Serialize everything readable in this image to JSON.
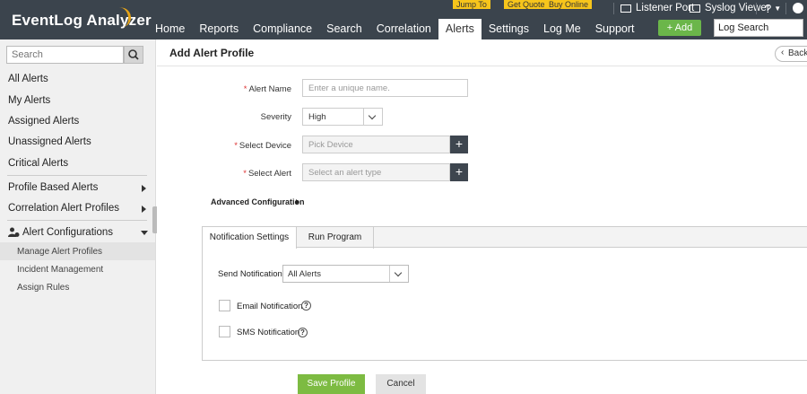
{
  "header": {
    "brand": "EventLog Analyzer",
    "nav": [
      "Home",
      "Reports",
      "Compliance",
      "Search",
      "Correlation",
      "Alerts",
      "Settings",
      "Log Me",
      "Support"
    ],
    "active_nav": "Alerts",
    "promos": {
      "jump_to": "Jump To",
      "get_quote": "Get Quote",
      "buy_online": "Buy Online"
    },
    "listener_port": "Listener Port",
    "syslog_viewer": "Syslog Viewer",
    "help": "?",
    "add_label": "+ Add",
    "log_search_value": "Log Search"
  },
  "sidebar": {
    "search_placeholder": "Search",
    "items": [
      "All Alerts",
      "My Alerts",
      "Assigned Alerts",
      "Unassigned Alerts",
      "Critical Alerts"
    ],
    "groups": [
      "Profile Based Alerts",
      "Correlation Alert Profiles"
    ],
    "alert_config": "Alert Configurations",
    "sub_items": [
      "Manage Alert Profiles",
      "Incident Management",
      "Assign Rules"
    ]
  },
  "main": {
    "title": "Add Alert Profile",
    "back": "Back",
    "form": {
      "alert_name_label": "Alert Name",
      "alert_name_placeholder": "Enter a unique name.",
      "severity_label": "Severity",
      "severity_value": "High",
      "select_device_label": "Select Device",
      "select_device_placeholder": "Pick Device",
      "select_alert_label": "Select Alert",
      "select_alert_placeholder": "Select an alert type",
      "advanced": "Advanced Configuration"
    },
    "tabs": [
      "Notification Settings",
      "Run Program"
    ],
    "notification": {
      "send_label": "Send Notification",
      "send_value": "All Alerts",
      "email": "Email Notification",
      "sms": "SMS Notification"
    },
    "buttons": {
      "save": "Save Profile",
      "cancel": "Cancel"
    }
  },
  "colors": {
    "header_bg": "#3b444d",
    "accent_green": "#7dbb42",
    "promo_yellow": "#f7c51b"
  }
}
